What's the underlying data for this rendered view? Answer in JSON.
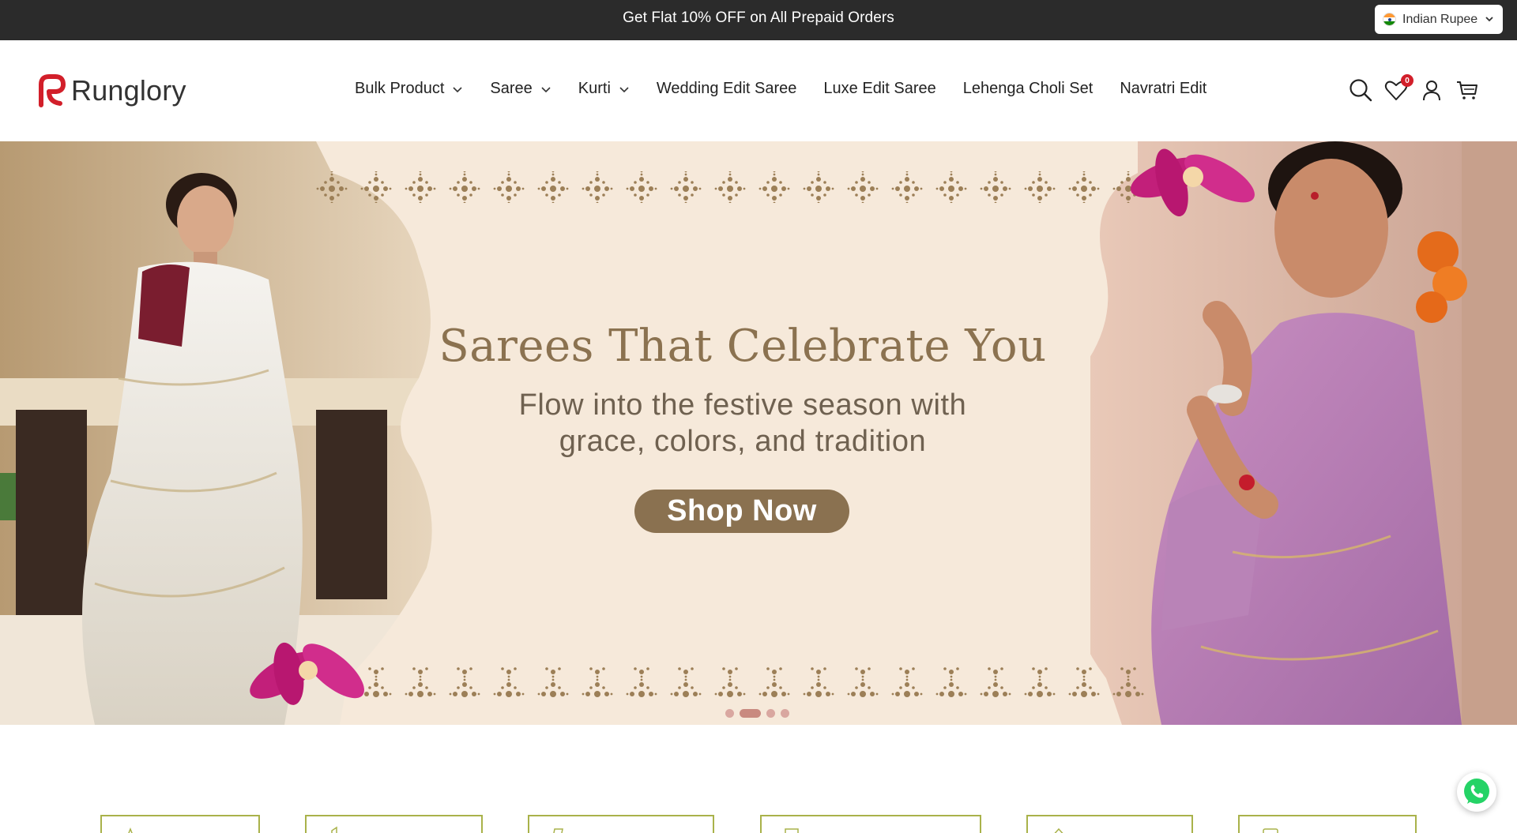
{
  "announcement": {
    "text": "Get Flat 10% OFF on All Prepaid Orders"
  },
  "currency": {
    "label": "Indian Rupee",
    "flag_icon": "india-flag-icon"
  },
  "brand": {
    "name": "Runglory",
    "accent": "#d21f2a"
  },
  "nav": {
    "items": [
      {
        "label": "Bulk Product",
        "has_dropdown": true
      },
      {
        "label": "Saree",
        "has_dropdown": true
      },
      {
        "label": "Kurti",
        "has_dropdown": true
      },
      {
        "label": "Wedding Edit Saree",
        "has_dropdown": false
      },
      {
        "label": "Luxe Edit Saree",
        "has_dropdown": false
      },
      {
        "label": "Lehenga Choli Set",
        "has_dropdown": false
      },
      {
        "label": "Navratri Edit",
        "has_dropdown": false
      }
    ]
  },
  "header_icons": {
    "search": "search-icon",
    "wishlist": "heart-icon",
    "wishlist_count": "0",
    "account": "user-icon",
    "cart": "cart-icon"
  },
  "hero": {
    "title": "Sarees That Celebrate You",
    "subtitle_line1": "Flow into the festive season with",
    "subtitle_line2": "grace, colors, and tradition",
    "cta": "Shop Now",
    "slide_count": 4,
    "active_slide": 2,
    "colors": {
      "background": "#f6e9da",
      "title": "#8b7250",
      "button": "#8a7150"
    }
  },
  "features": {
    "border_color": "#a9b24a",
    "count": 6
  },
  "whatsapp": {
    "icon": "whatsapp-icon",
    "color": "#25d366"
  }
}
